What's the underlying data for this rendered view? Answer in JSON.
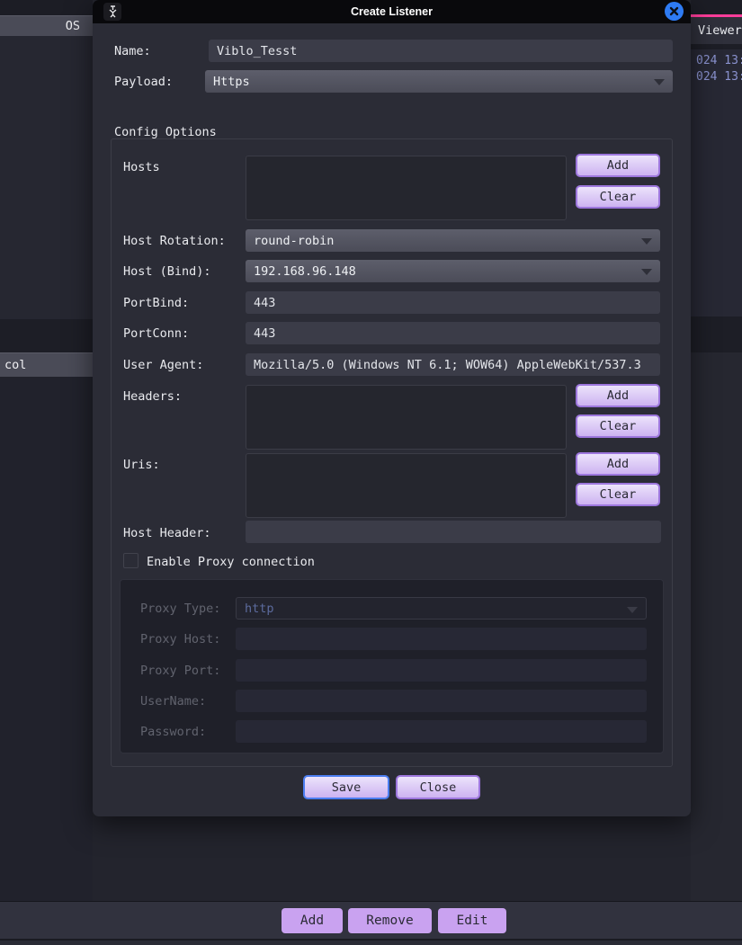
{
  "window": {
    "title": "Create Listener"
  },
  "form": {
    "name_label": "Name:",
    "name_value": "Viblo_Tesst",
    "payload_label": "Payload:",
    "payload_value": "Https"
  },
  "config": {
    "section_title": "Config Options",
    "hosts_label": "Hosts",
    "add_label": "Add",
    "clear_label": "Clear",
    "host_rotation_label": "Host Rotation:",
    "host_rotation_value": "round-robin",
    "host_bind_label": "Host (Bind):",
    "host_bind_value": "192.168.96.148",
    "port_bind_label": "PortBind:",
    "port_bind_value": "443",
    "port_conn_label": "PortConn:",
    "port_conn_value": "443",
    "user_agent_label": "User Agent:",
    "user_agent_value": "Mozilla/5.0 (Windows NT 6.1; WOW64) AppleWebKit/537.3",
    "headers_label": "Headers:",
    "uris_label": "Uris:",
    "host_header_label": "Host Header:",
    "enable_proxy_label": "Enable Proxy connection"
  },
  "proxy": {
    "type_label": "Proxy Type:",
    "type_value": "http",
    "host_label": "Proxy Host:",
    "port_label": "Proxy Port:",
    "username_label": "UserName:",
    "password_label": "Password:"
  },
  "dialog_actions": {
    "save_label": "Save",
    "close_label": "Close"
  },
  "background": {
    "os_header": "OS",
    "col_header": "col",
    "viewer_tab": "Viewer",
    "log_lines": [
      "024 13:",
      "024 13:"
    ],
    "toolbar": {
      "add_label": "Add",
      "remove_label": "Remove",
      "edit_label": "Edit"
    }
  },
  "colors": {
    "accent_purple": "#c9a2f0",
    "accent_blue": "#2e7bf3",
    "accent_pink": "#ff3d9a"
  }
}
